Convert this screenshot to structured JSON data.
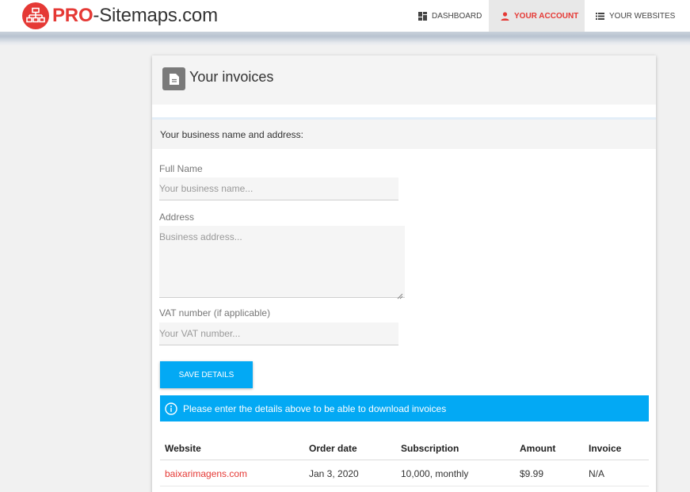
{
  "brand": {
    "pro": "PRO",
    "rest": "-Sitemaps.com",
    "accent": "#e53935"
  },
  "nav": {
    "dashboard": {
      "label": "DASHBOARD",
      "icon": "dashboard-icon"
    },
    "account": {
      "label": "YOUR ACCOUNT",
      "icon": "person-icon",
      "active": true
    },
    "websites": {
      "label": "YOUR WEBSITES",
      "icon": "list-icon"
    }
  },
  "page": {
    "title": "Your invoices",
    "icon": "document-icon"
  },
  "business": {
    "section_label": "Your business name and address:",
    "full_name": {
      "label": "Full Name",
      "placeholder": "Your business name...",
      "value": ""
    },
    "address": {
      "label": "Address",
      "placeholder": "Business address...",
      "value": ""
    },
    "vat": {
      "label": "VAT number (if applicable)",
      "placeholder": "Your VAT number...",
      "value": ""
    },
    "save_label": "SAVE DETAILS"
  },
  "alert": {
    "icon": "info-icon",
    "text": "Please enter the details above to be able to download invoices",
    "color": "#03a9f4"
  },
  "invoices": {
    "columns": [
      "Website",
      "Order date",
      "Subscription",
      "Amount",
      "Invoice"
    ],
    "rows": [
      {
        "website": "baixarimagens.com",
        "order_date": "Jan 3, 2020",
        "subscription": "10,000, monthly",
        "amount": "$9.99",
        "invoice": "N/A"
      }
    ]
  }
}
